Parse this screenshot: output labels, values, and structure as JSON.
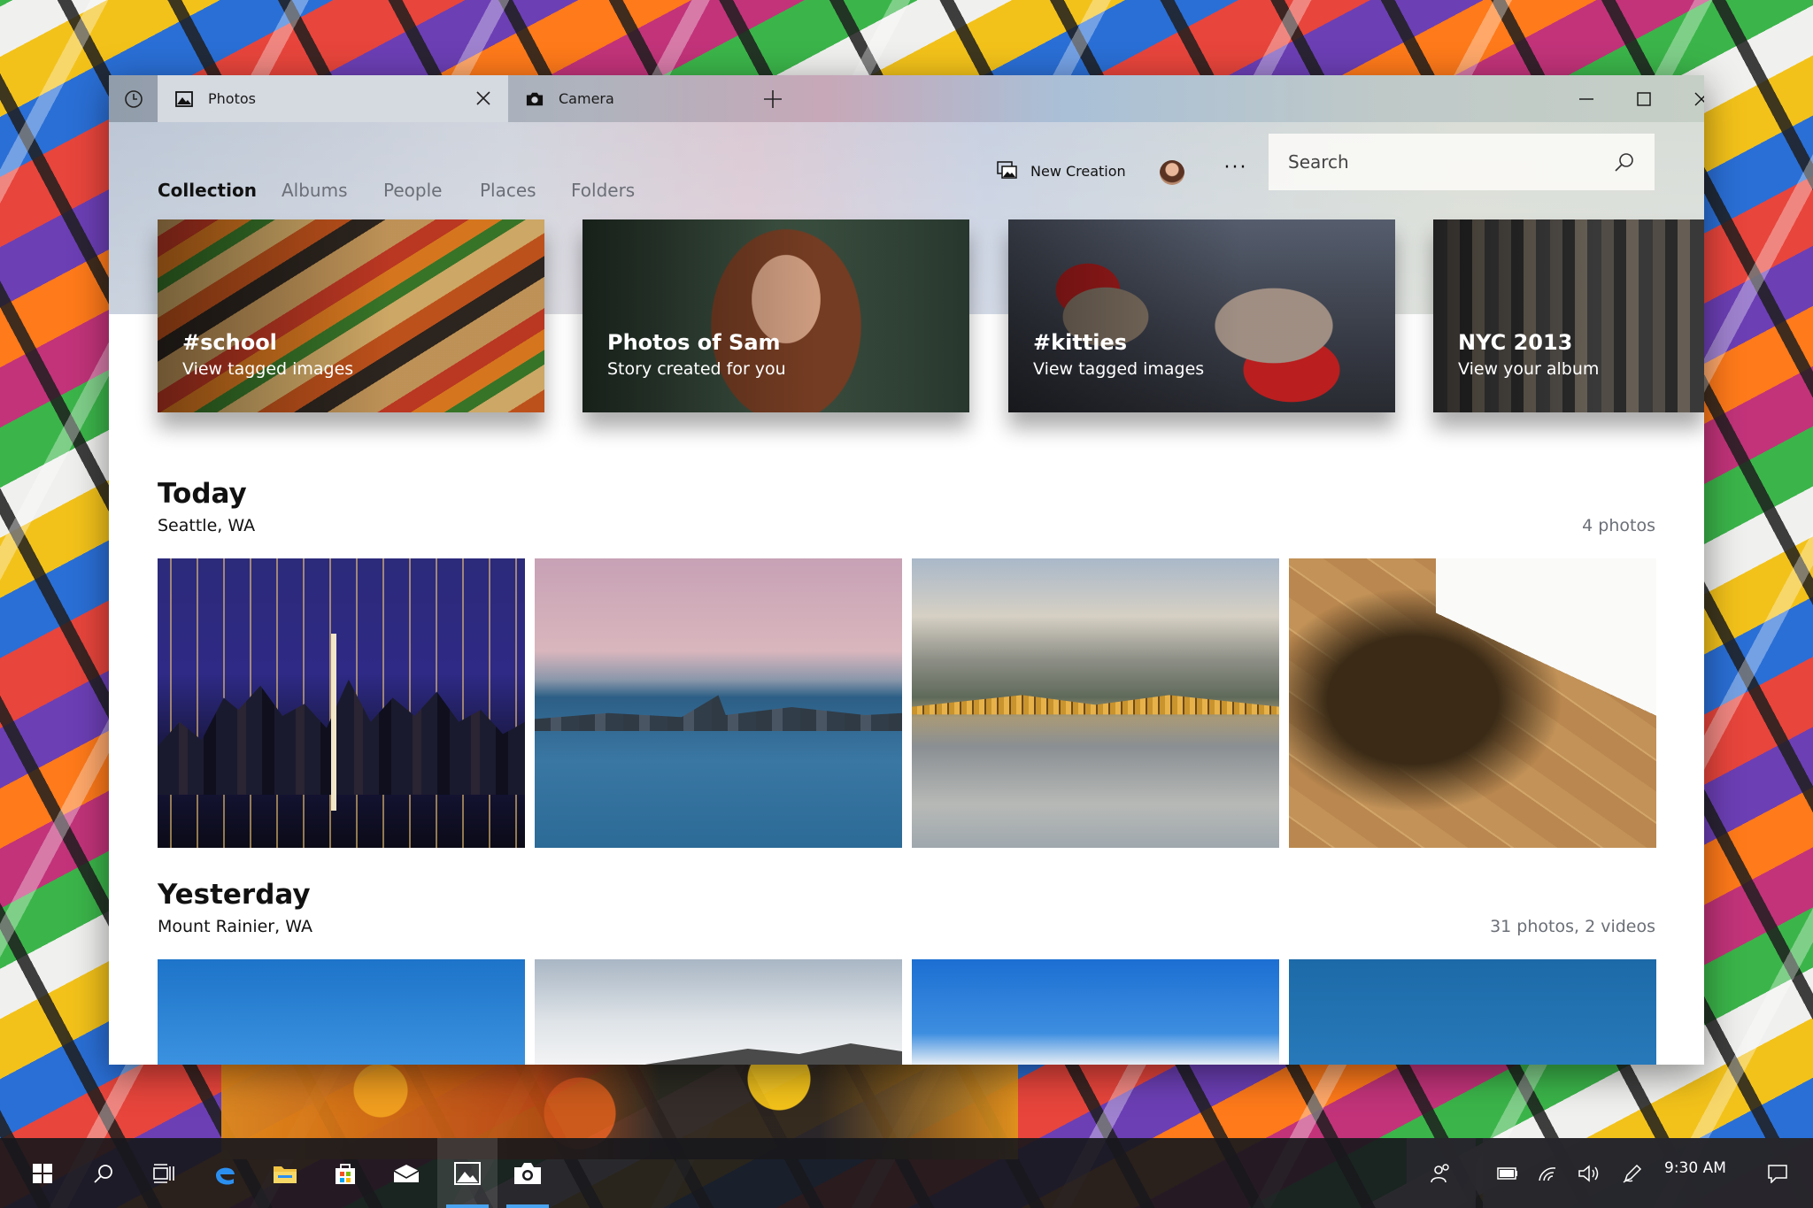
{
  "window": {
    "tabs": [
      {
        "label": "Photos",
        "icon": "photos-icon",
        "active": true
      },
      {
        "label": "Camera",
        "icon": "camera-icon",
        "active": false
      }
    ]
  },
  "nav": {
    "items": [
      "Collection",
      "Albums",
      "People",
      "Places",
      "Folders"
    ],
    "selected": "Collection",
    "new_creation_label": "New Creation",
    "more_label": "···",
    "search_placeholder": "Search"
  },
  "cards": [
    {
      "title": "#school",
      "subtitle": "View tagged images"
    },
    {
      "title": "Photos of Sam",
      "subtitle": "Story created for you"
    },
    {
      "title": "#kitties",
      "subtitle": "View tagged images"
    },
    {
      "title": "NYC 2013",
      "subtitle": "View your album"
    }
  ],
  "sections": [
    {
      "title": "Today",
      "location": "Seattle, WA",
      "count": "4 photos"
    },
    {
      "title": "Yesterday",
      "location": "Mount Rainier, WA",
      "count": "31 photos, 2 videos"
    }
  ],
  "taskbar": {
    "clock": "9:30 AM",
    "accent": "#4aa3f0"
  }
}
